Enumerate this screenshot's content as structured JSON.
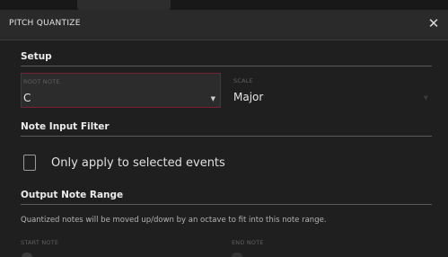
{
  "dialog": {
    "title": "PITCH QUANTIZE",
    "close_icon": "close-icon"
  },
  "setup": {
    "heading": "Setup",
    "root_note": {
      "label": "ROOT NOTE",
      "value": "C"
    },
    "scale": {
      "label": "SCALE",
      "value": "Major"
    }
  },
  "note_input_filter": {
    "heading": "Note Input Filter",
    "checkbox_label": "Only apply to selected events",
    "checked": false
  },
  "output_note_range": {
    "heading": "Output Note Range",
    "description": "Quantized notes will be moved up/down by an octave to fit into this note range.",
    "start_note_label": "START NOTE",
    "end_note_label": "END NOTE"
  },
  "colors": {
    "background": "#1f1f1f",
    "titlebar": "#2a2a2a",
    "focus_border": "#7a1f33",
    "text": "#e6e6e6"
  }
}
